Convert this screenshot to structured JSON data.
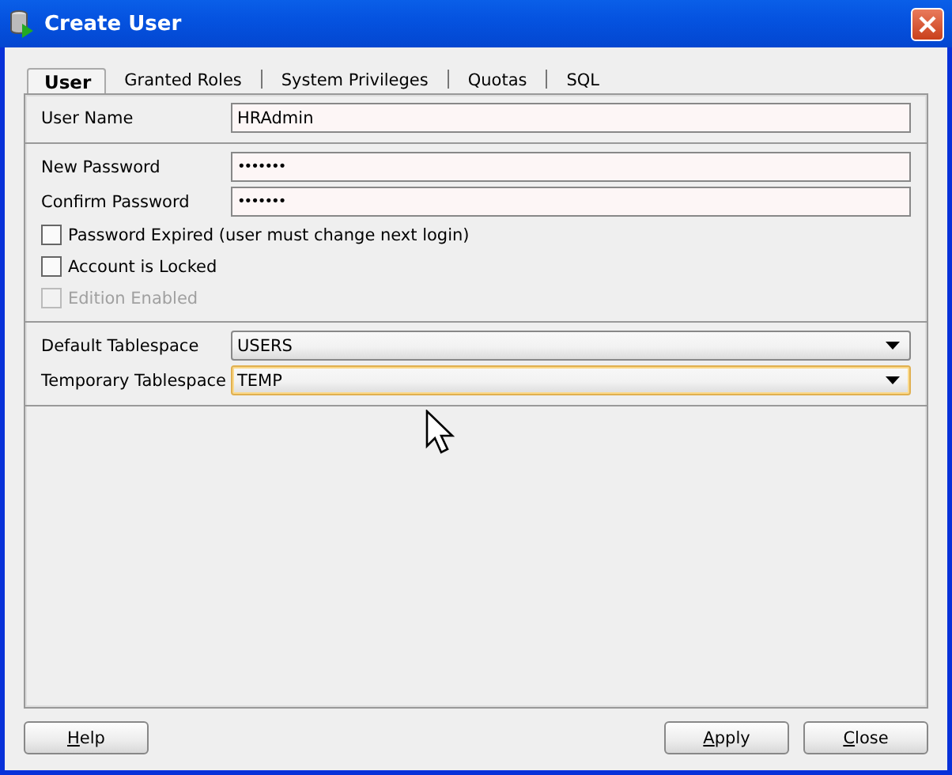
{
  "window": {
    "title": "Create User"
  },
  "tabs": [
    {
      "label": "User",
      "selected": true
    },
    {
      "label": "Granted Roles",
      "selected": false
    },
    {
      "label": "System Privileges",
      "selected": false
    },
    {
      "label": "Quotas",
      "selected": false
    },
    {
      "label": "SQL",
      "selected": false
    }
  ],
  "sections": [
    {
      "fields": [
        {
          "kind": "text",
          "label": "User Name",
          "value": "HRAdmin"
        }
      ]
    },
    {
      "fields": [
        {
          "kind": "password",
          "label": "New Password",
          "value": "•••••••"
        },
        {
          "kind": "password",
          "label": "Confirm Password",
          "value": "•••••••"
        },
        {
          "kind": "checkbox",
          "label": "Password Expired (user must change next login)",
          "checked": false,
          "disabled": false
        },
        {
          "kind": "checkbox",
          "label": "Account is Locked",
          "checked": false,
          "disabled": false
        },
        {
          "kind": "checkbox",
          "label": "Edition Enabled",
          "checked": false,
          "disabled": true
        }
      ]
    },
    {
      "fields": [
        {
          "kind": "select",
          "label": "Default Tablespace",
          "value": "USERS",
          "focused": false
        },
        {
          "kind": "select",
          "label": "Temporary Tablespace",
          "value": "TEMP",
          "focused": true
        }
      ]
    }
  ],
  "buttons_left": [
    {
      "label": "Help",
      "mnemonic_first": true
    }
  ],
  "buttons_right": [
    {
      "label": "Apply",
      "mnemonic_first": true
    },
    {
      "label": "Close",
      "mnemonic_first": true
    }
  ]
}
